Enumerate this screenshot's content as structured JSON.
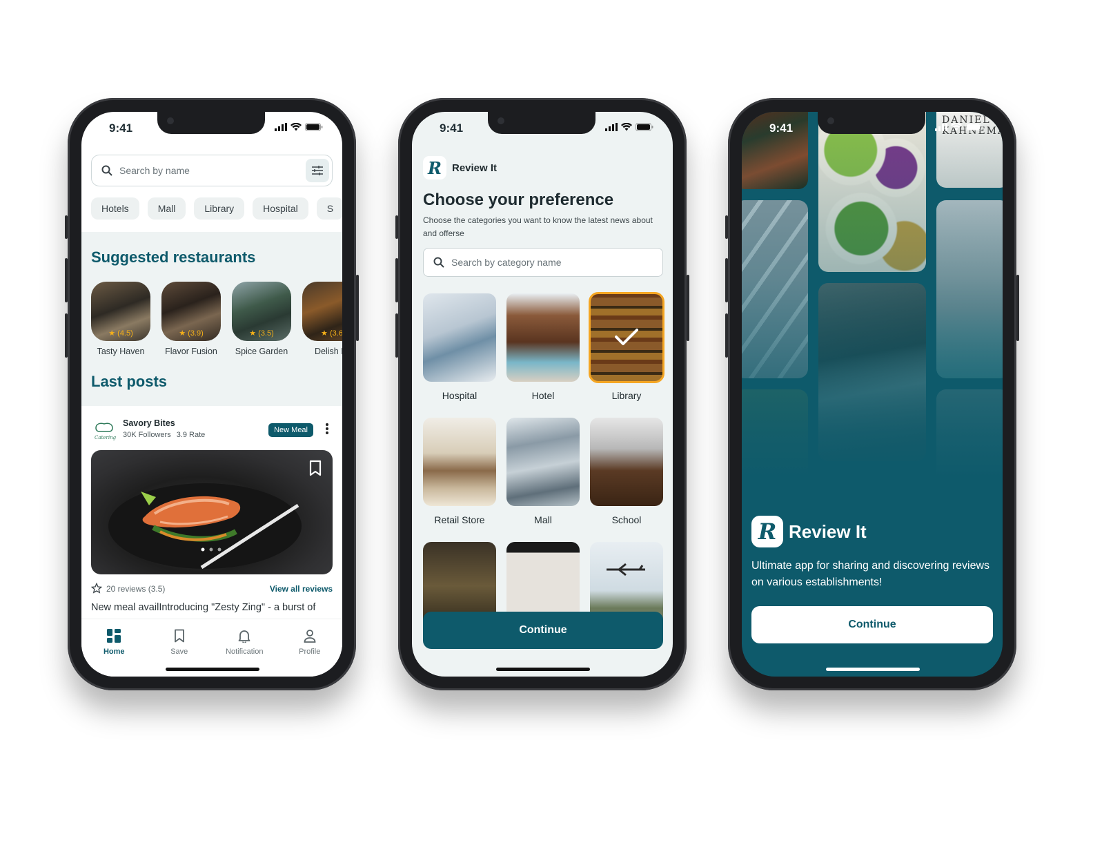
{
  "status_time": "9:41",
  "home": {
    "search_placeholder": "Search by name",
    "chips": [
      "Hotels",
      "Mall",
      "Library",
      "Hospital",
      "S"
    ],
    "suggested_title": "Suggested restaurants",
    "restaurants": [
      {
        "name": "Tasty Haven",
        "rating": "(4.5)"
      },
      {
        "name": "Flavor Fusion",
        "rating": "(3.9)"
      },
      {
        "name": "Spice Garden",
        "rating": "(3.5)"
      },
      {
        "name": "Delish Di",
        "rating": "(3.6"
      }
    ],
    "last_posts_title": "Last posts",
    "post": {
      "author": "Savory Bites",
      "followers": "30K Followers",
      "rate": "3.9 Rate",
      "badge": "New Meal",
      "reviews": "20 reviews (3.5)",
      "view_all": "View all reviews",
      "text": "New meal availIntroducing \"Zesty Zing\" - a burst of"
    },
    "tabs": [
      "Home",
      "Save",
      "Notification",
      "Profile"
    ]
  },
  "prefs": {
    "app_name": "Review It",
    "title": "Choose your preference",
    "subtitle": "Choose the categories you want to know the latest news about and offerse",
    "search_placeholder": "Search by category name",
    "categories": [
      "Hospital",
      "Hotel",
      "Library",
      "Retail Store",
      "Mall",
      "School"
    ],
    "selected": "Library",
    "continue": "Continue"
  },
  "welcome": {
    "app_name": "Review It",
    "tagline": "Ultimate app for sharing and discovering reviews on various establishments!",
    "continue": "Continue"
  },
  "colors": {
    "brand": "#0e5a6b",
    "star": "#f5b019",
    "selected_outline": "#f5a623"
  }
}
